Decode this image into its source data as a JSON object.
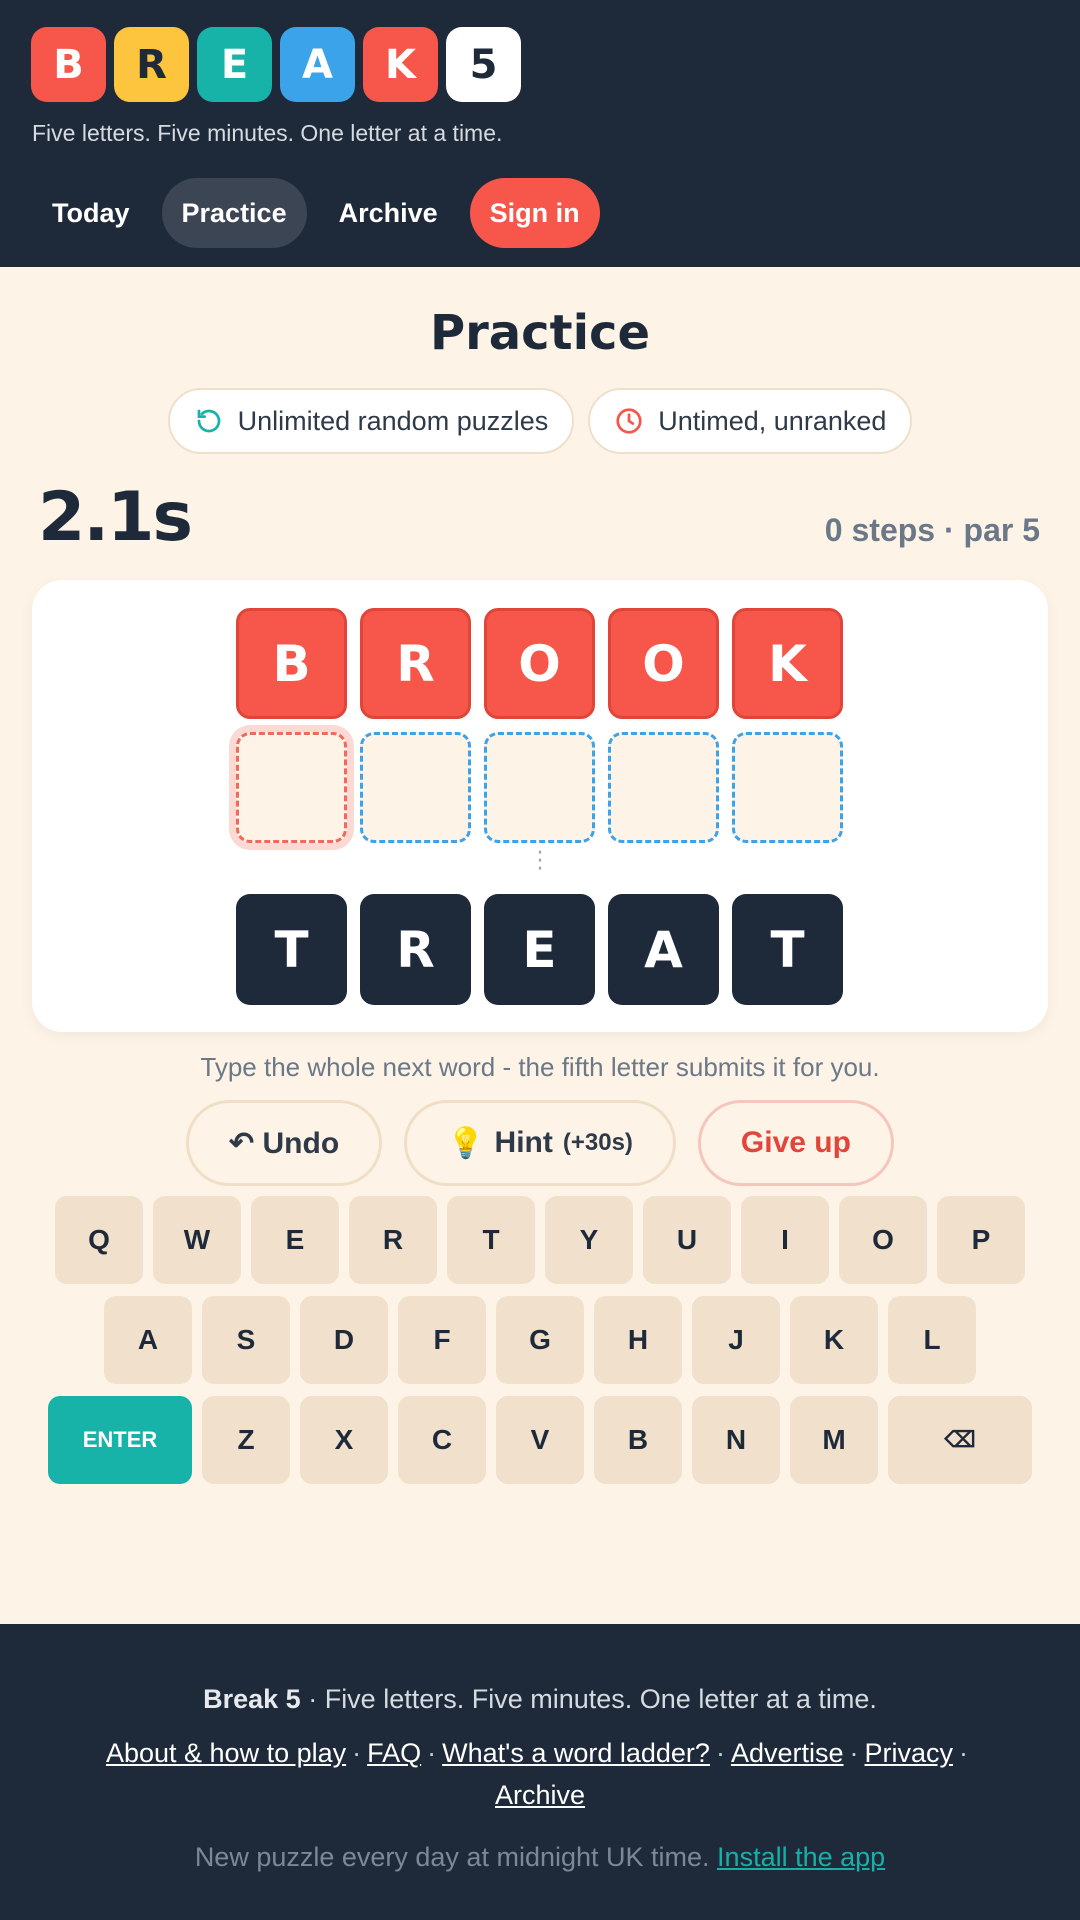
{
  "header": {
    "logo_letters": [
      "B",
      "R",
      "E",
      "A",
      "K",
      "5"
    ],
    "logo_colors": [
      "#f7574a",
      "#fcc53d",
      "#17b3a8",
      "#3aa3ea",
      "#f7574a",
      "#ffffff"
    ],
    "tagline": "Five letters. Five minutes. One letter at a time.",
    "nav": {
      "today": "Today",
      "practice": "Practice",
      "archive": "Archive",
      "signin": "Sign in"
    }
  },
  "main": {
    "title": "Practice",
    "pill_random": "Unlimited random puzzles",
    "pill_untimed": "Untimed, unranked",
    "timer": "2.1s",
    "steps": "0 steps · par 5",
    "start_word": [
      "B",
      "R",
      "O",
      "O",
      "K"
    ],
    "target_word": [
      "T",
      "R",
      "E",
      "A",
      "T"
    ],
    "instruction": "Type the whole next word - the fifth letter submits it for you."
  },
  "actions": {
    "undo": "↶ Undo",
    "hint_icon": "💡",
    "hint": "Hint",
    "hint_penalty": "(+30s)",
    "giveup": "Give up"
  },
  "keyboard": {
    "row1": [
      "Q",
      "W",
      "E",
      "R",
      "T",
      "Y",
      "U",
      "I",
      "O",
      "P"
    ],
    "row2": [
      "A",
      "S",
      "D",
      "F",
      "G",
      "H",
      "J",
      "K",
      "L"
    ],
    "row3": [
      "Z",
      "X",
      "C",
      "V",
      "B",
      "N",
      "M"
    ],
    "enter": "ENTER",
    "backspace": "⌫"
  },
  "footer": {
    "brand": "Break 5",
    "tagline": "· Five letters. Five minutes. One letter at a time.",
    "links": {
      "about": "About & how to play",
      "faq": "FAQ",
      "word_ladder": "What's a word ladder?",
      "advertise": "Advertise",
      "privacy": "Privacy",
      "archive": "Archive"
    },
    "separator": "·",
    "note": "New puzzle every day at midnight UK time.",
    "install": "Install the app"
  },
  "colors": {
    "navy": "#1e2a3a",
    "coral": "#f7574a",
    "teal": "#17b3a8",
    "blue": "#3aa3ea",
    "cream": "#fdf3e7"
  }
}
